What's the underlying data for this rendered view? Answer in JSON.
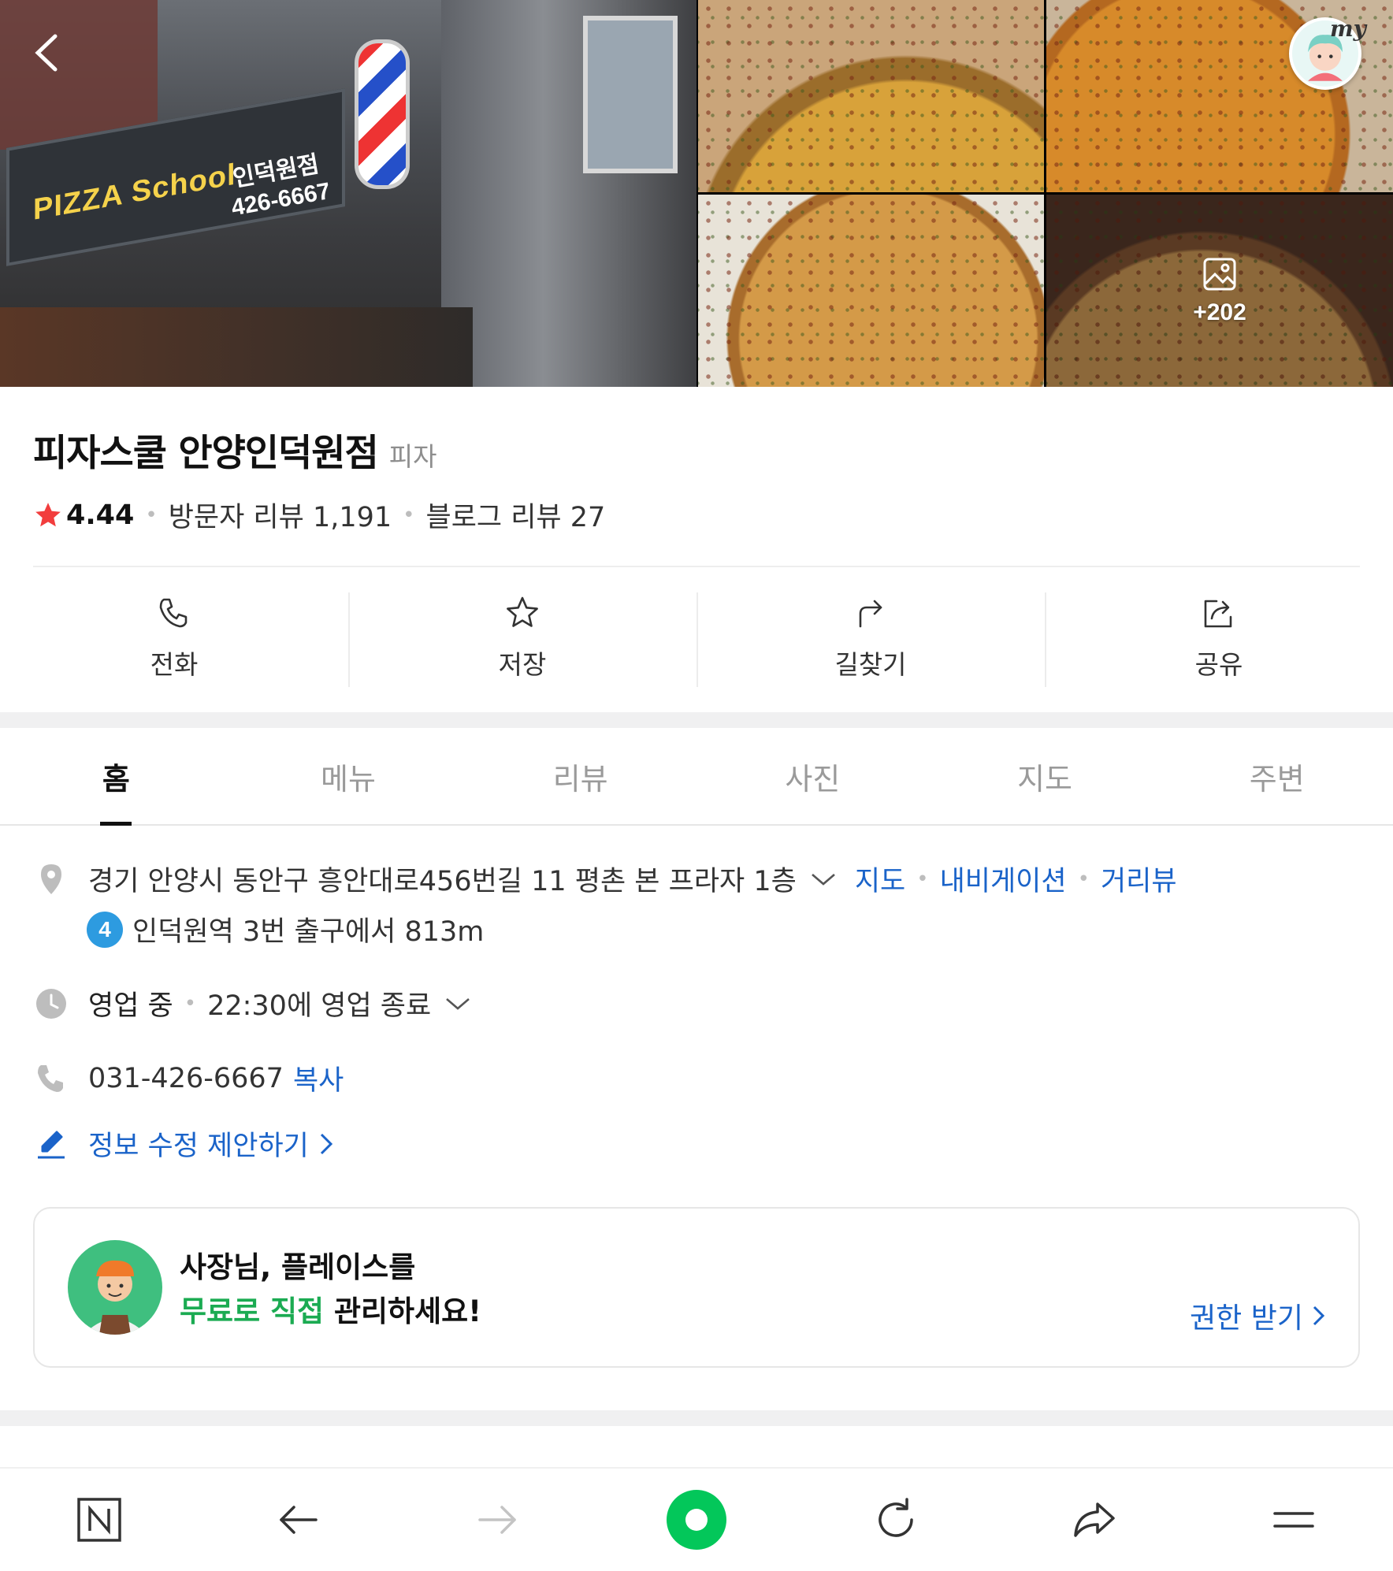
{
  "header": {
    "sign_pizza": "PIZZA School",
    "sign_branch_line1": "인덕원점",
    "sign_branch_line2": "426-6667",
    "more_photos_count": "+202"
  },
  "place": {
    "name": "피자스쿨 안양인덕원점",
    "category": "피자",
    "rating": "4.44",
    "visitor_reviews": "방문자 리뷰 1,191",
    "blog_reviews": "블로그 리뷰 27"
  },
  "actions": [
    {
      "label": "전화",
      "icon": "phone-icon"
    },
    {
      "label": "저장",
      "icon": "star-icon"
    },
    {
      "label": "길찾기",
      "icon": "directions-icon"
    },
    {
      "label": "공유",
      "icon": "share-icon"
    }
  ],
  "tabs": [
    {
      "label": "홈",
      "active": true
    },
    {
      "label": "메뉴",
      "active": false
    },
    {
      "label": "리뷰",
      "active": false
    },
    {
      "label": "사진",
      "active": false
    },
    {
      "label": "지도",
      "active": false
    },
    {
      "label": "주변",
      "active": false
    }
  ],
  "details": {
    "address": "경기 안양시 동안구 흥안대로456번길 11 평촌 본 프라자 1층",
    "map_link": "지도",
    "navigation_link": "내비게이션",
    "streetview_link": "거리뷰",
    "subway_line": "4",
    "subway_text": "인덕원역 3번 출구에서 813m",
    "status": "영업 중",
    "hours": "22:30에 영업 종료",
    "phone": "031-426-6667",
    "copy_link": "복사",
    "suggest_edit": "정보 수정 제안하기"
  },
  "owner_card": {
    "line1": "사장님, 플레이스를",
    "line2_highlight": "무료로 직접",
    "line2_rest": " 관리하세요!",
    "cta": "권한 받기"
  },
  "colors": {
    "link_blue": "#1a63c9",
    "green_accent": "#1bab52",
    "star_red": "#f23d3d",
    "naver_green": "#03c75a",
    "subway_line4": "#2d9be0"
  }
}
